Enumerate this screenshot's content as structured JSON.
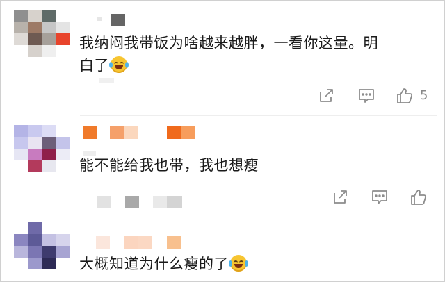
{
  "colors": {
    "text": "#1a1a1a",
    "icon": "#8c8c8c",
    "background": "#ffffff",
    "emoji_face": "#f7c531"
  },
  "comments": [
    {
      "text": "我纳闷我带饭为啥越来越胖，一看你这量。明白了",
      "text_line1": "我纳闷我带饭为啥越来越胖，一看你这量。明",
      "text_line2": "白了",
      "emoji": "laugh-cry-emoji",
      "likes": "5",
      "icons": [
        "share-icon",
        "comment-icon",
        "thumbs-up-icon"
      ]
    },
    {
      "text": "能不能给我也带，我也想瘦",
      "icons": [
        "share-icon",
        "comment-icon",
        "thumbs-up-icon"
      ]
    },
    {
      "text": "大概知道为什么瘦的了",
      "emoji": "laugh-cry-emoji"
    }
  ]
}
